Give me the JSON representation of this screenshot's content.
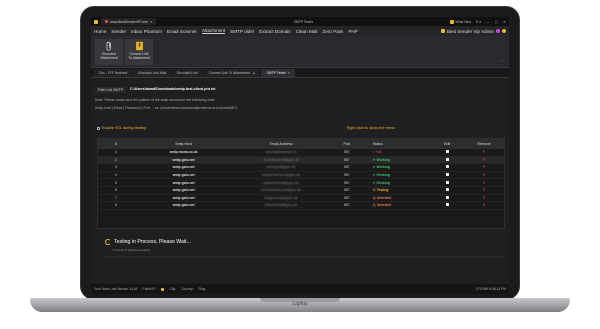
{
  "window": {
    "browser_tab": "www.BestSenderVIP.com",
    "title": "SMTP Tester",
    "what_new": "What New",
    "lang": "E"
  },
  "menu": [
    "Home",
    "Sender",
    "Inbox Phantom",
    "Email Scanner",
    "Attachment",
    "SMTP older",
    "Extract Domain",
    "Clean Mail",
    "Zero Pass",
    "PHP"
  ],
  "menu_right": "Best Sender Vip Admin",
  "ribbon": [
    {
      "label1": "Encoded",
      "label2": "Attachment"
    },
    {
      "label1": "Convert Link",
      "label2": "To Attachment"
    }
  ],
  "doc_tabs": [
    "Zoc - TFF Redirect",
    "Encoded Link Mail",
    "Encoded Link",
    "Convert Link To Attachment",
    "SMTP Tester"
  ],
  "path": {
    "label": "Path List SMTP",
    "value": "C:\\Users\\buwd\\Downloads\\smtp-test-client-pro.txt"
  },
  "notes": [
    "Note: Please make sure the pattern of the smtp account in the following order -",
    "Smtp host | Email | Password | Port  ... ex: (exlservena.ex|ondros@exlservena.ex|horse|587)"
  ],
  "options": {
    "ssl_label": "Enable SSL during testing",
    "hint": "Right click to show the menu"
  },
  "grid": {
    "headers": [
      "#",
      "Smtp Host",
      "Email Address",
      "Port",
      "Status",
      "Edit",
      "Remove"
    ],
    "rows": [
      {
        "n": "1",
        "host": "smtp.mona.co.uk",
        "email": "arsuha@baandoh.fo",
        "port": "587",
        "status": "Fail",
        "state": "fail"
      },
      {
        "n": "2",
        "host": "smtp.gxiu.net",
        "email": "merfolkaust.rlf@gxiu.de",
        "port": "587",
        "status": "Working",
        "state": "work"
      },
      {
        "n": "3",
        "host": "smtp.gxiu.net",
        "email": "pleringnot@gxiu.de",
        "port": "587",
        "status": "Working",
        "state": "work"
      },
      {
        "n": "4",
        "host": "smtp.gxiu.net",
        "email": "nepperfancount@gxiu.de",
        "port": "587",
        "status": "Working",
        "state": "work"
      },
      {
        "n": "5",
        "host": "smtp.gxiu.net",
        "email": "quakanomind@gxiu.net",
        "port": "587",
        "status": "Working",
        "state": "work"
      },
      {
        "n": "6",
        "host": "smtp.gxiu.net",
        "email": "phrazefattstruuth@gxiu.de",
        "port": "587",
        "status": "Testing",
        "state": "test"
      },
      {
        "n": "7",
        "host": "smtp.gxiu.net",
        "email": "brugervanda@gxiu.de",
        "port": "587",
        "status": "Untested",
        "state": "unt"
      },
      {
        "n": "8",
        "host": "smtp.gxiu.net",
        "email": "fadrenebodt@gxiu.de",
        "port": "587",
        "status": "Untested",
        "state": "unt"
      }
    ]
  },
  "progress": {
    "title": "Testing in Process, Please Wait...",
    "sub": "5 out of 17 has been tested"
  },
  "status": {
    "version": "Your Have Last Version 14.61",
    "public": "Public IP:",
    "city": "City:",
    "country": "Country:",
    "flag": "Flag:",
    "datetime": "7/7/1999 8:58:13 PM"
  }
}
